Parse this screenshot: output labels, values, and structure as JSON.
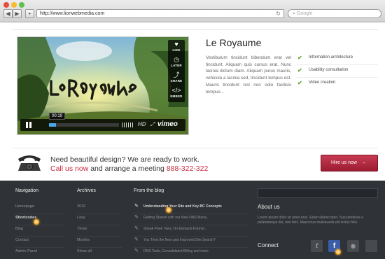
{
  "browser": {
    "url": "http://www.lionwebmedia.com",
    "search_placeholder": "Google",
    "back_icon": "◀",
    "forward_icon": "▶",
    "plus_icon": "+",
    "reload_icon": "↻",
    "search_icon": "⌕"
  },
  "video": {
    "title_art": "LeRoyaume",
    "side_buttons": [
      {
        "icon": "heart-icon",
        "glyph": "♥",
        "label": "LIKE"
      },
      {
        "icon": "clock-icon",
        "glyph": "◷",
        "label": "LATER"
      },
      {
        "icon": "share-icon",
        "glyph": "⤴",
        "label": "SHARE"
      },
      {
        "icon": "embed-icon",
        "glyph": "</>",
        "label": "EMBED"
      }
    ],
    "time": "00:19",
    "progress": 0.1,
    "hd_label": "HD",
    "fullscreen_glyph": "⤢",
    "brand": "vimeo"
  },
  "content": {
    "title": "Le Royaume",
    "description": "Vestibulum tincidunt bibendum erat vel tincidunt. Aliquam quis cursus erat. Nunc lacinia dictum diam. Aliquam purus mauris, vehicula a lacinia sed, tincidunt tempus est. Mauris tincidunt nisl non odio facilisis tempus...",
    "features": [
      "Information architecture",
      "Usability consultation",
      "Video creation"
    ],
    "check_glyph": "✔"
  },
  "cta": {
    "line1": "Need beautiful design? We are ready to work.",
    "call": "Call us now",
    "middle": "and arrange a meeting",
    "phone": "888-322-322",
    "button": "Hire us now",
    "button_arrow": "→"
  },
  "footer": {
    "navigation": {
      "heading": "Navigation",
      "items": [
        "Homepage",
        "Shortcodes",
        "Blog",
        "Contact",
        "Admin Panel"
      ]
    },
    "archives": {
      "heading": "Archives",
      "items": [
        "2010",
        "Lasy",
        "Three",
        "Months",
        "Show all"
      ]
    },
    "blog": {
      "heading": "From the blog",
      "items": [
        "Understanding Your Site and Key BC Concepts",
        "Getting Started with our New DNS Mana...",
        "Sneak Peek: New, On-Demand Partner...",
        "You Tried the New and Improved Site Search?",
        "DNS Tools, Consolidated Billing and more"
      ],
      "pen_glyph": "✎"
    },
    "search_placeholder": "",
    "about": {
      "heading": "About us",
      "text": "Lorem ipsum dolor sit amet eros. Etiam ullamcorper. Sus pendisse a pellentesque dui, non felis. Maecenas malesuada elit lectus felis."
    },
    "connect": {
      "heading": "Connect",
      "social": [
        {
          "name": "twitter-icon",
          "glyph": "t"
        },
        {
          "name": "facebook-icon",
          "glyph": "f"
        },
        {
          "name": "rss-icon",
          "glyph": "◉"
        },
        {
          "name": "social-icon",
          "glyph": ""
        }
      ]
    }
  },
  "colors": {
    "accent_red": "#c92a3e",
    "footer_bg": "#2f3236",
    "check_green": "#5ca733",
    "facebook_blue": "#3b5da8",
    "vimeo_progress": "#4aa8e8"
  }
}
